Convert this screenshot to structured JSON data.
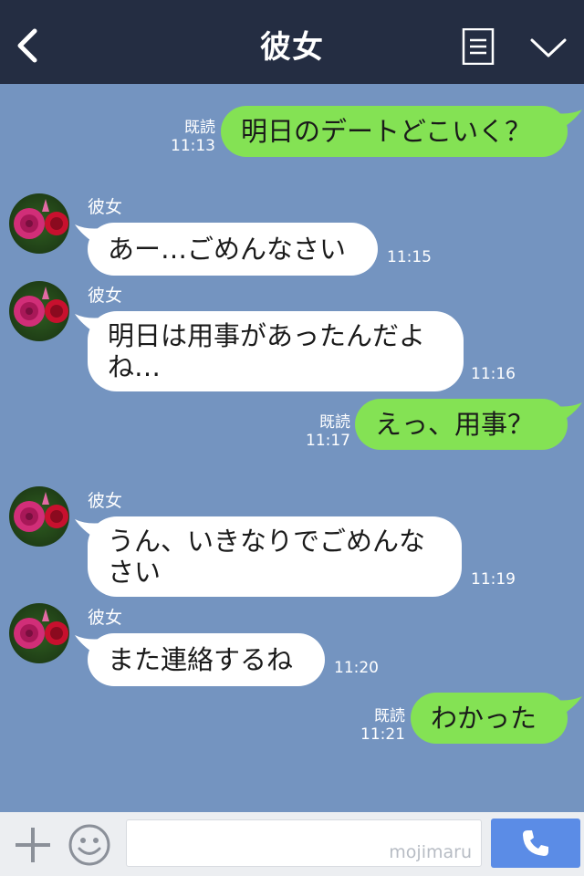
{
  "header": {
    "title": "彼女",
    "back_icon": "chevron-left-icon",
    "menu_icon": "notes-icon",
    "collapse_icon": "chevron-down-icon"
  },
  "contact": {
    "name": "彼女",
    "avatar": "rose-avatar"
  },
  "messages": [
    {
      "dir": "out",
      "text": "明日のデートどこいく？",
      "read": "既読",
      "time": "11:13"
    },
    {
      "dir": "in",
      "name": "彼女",
      "text": "あー…ごめんなさい",
      "time": "11:15"
    },
    {
      "dir": "in",
      "name": "彼女",
      "text": "明日は用事があったんだよね…",
      "time": "11:16"
    },
    {
      "dir": "out",
      "text": "えっ、用事？",
      "read": "既読",
      "time": "11:17"
    },
    {
      "dir": "in",
      "name": "彼女",
      "text": "うん、いきなりでごめんなさい",
      "time": "11:19"
    },
    {
      "dir": "in",
      "name": "彼女",
      "text": "また連絡するね",
      "time": "11:20"
    },
    {
      "dir": "out",
      "text": "わかった",
      "read": "既読",
      "time": "11:21"
    }
  ],
  "composer": {
    "plus_icon": "plus-icon",
    "sticker_icon": "smile-icon",
    "input_value": "",
    "watermark": "mojimaru",
    "call_icon": "phone-icon"
  },
  "colors": {
    "header_bg": "#242d42",
    "chat_bg": "#7494c0",
    "outgoing_bubble": "#84e254",
    "incoming_bubble": "#ffffff",
    "call_button": "#5b8ce6"
  }
}
